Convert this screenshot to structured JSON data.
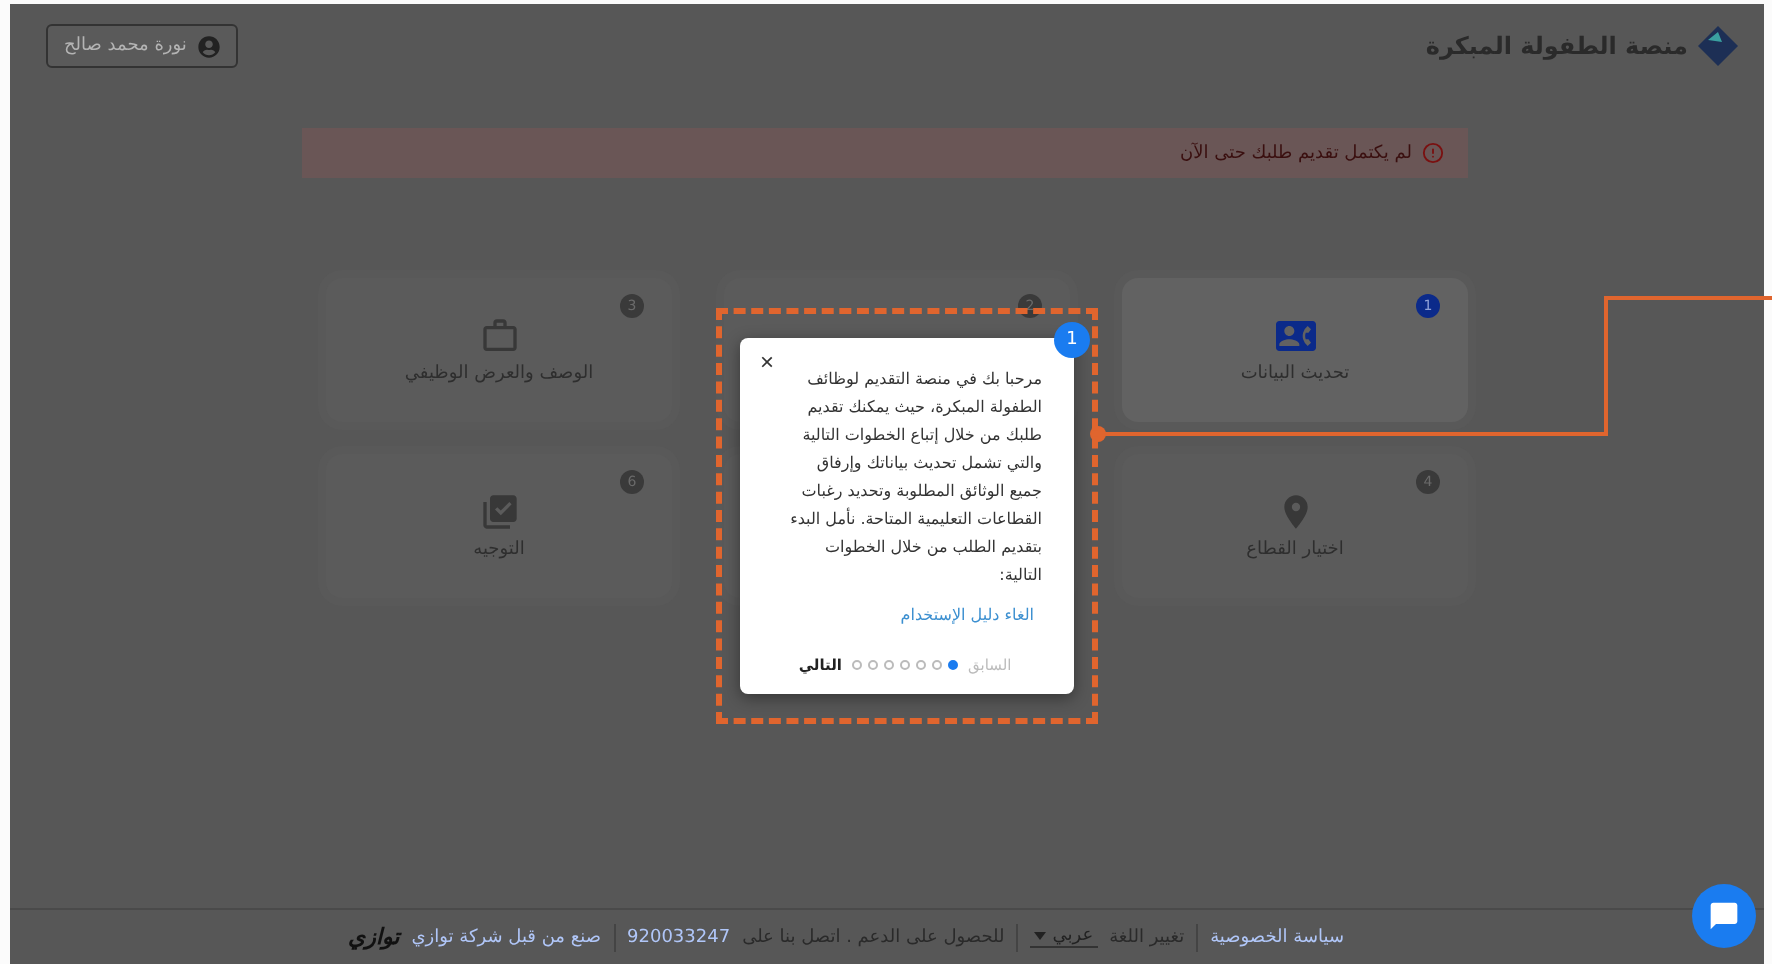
{
  "header": {
    "logo_text": "منصة الطفولة المبكرة",
    "user_button": "نورة محمد صالح"
  },
  "alert": {
    "text": "لم يكتمل تقديم طلبك حتى الآن"
  },
  "steps": [
    {
      "number": "1",
      "label": "تحديث البيانات",
      "kind": "contact",
      "active": true
    },
    {
      "number": "2",
      "kind": "blank",
      "active": false
    },
    {
      "number": "3",
      "label": "الوصف والعرض الوظيفي",
      "kind": "briefcase",
      "active": false
    },
    {
      "number": "4",
      "label": "اختيار القطاع",
      "kind": "pin",
      "active": false
    },
    {
      "kind": "blank"
    },
    {
      "number": "6",
      "label": "التوجيه",
      "kind": "checklist",
      "active": false
    }
  ],
  "tour": {
    "step_badge": "1",
    "text": "مرحبا بك في منصة التقديم لوظائف الطفولة المبكرة، حيث يمكنك تقديم طلبك من خلال إتباع الخطوات التالية والتي تشمل تحديث بياناتك وإرفاق جميع الوثائق المطلوبة وتحديد رغبات القطاعات التعليمية المتاحة. نأمل البدء بتقديم الطلب من خلال الخطوات التالية:",
    "close": "×",
    "skip_link": "الغاء دليل الإستخدام",
    "prev": {
      "label": "السابق",
      "disabled": true
    },
    "next": {
      "label": "التالي",
      "disabled": false
    },
    "dots": [
      {
        "selected": true
      },
      {
        "selected": false
      },
      {
        "selected": false
      },
      {
        "selected": false
      },
      {
        "selected": false
      },
      {
        "selected": false
      },
      {
        "selected": false
      }
    ]
  },
  "footer": {
    "privacy_link": "سياسة الخصوصية",
    "language_label": "تغيير اللغة",
    "language_value": "عربي",
    "support_text": "للحصول على الدعم . اتصل بنا على",
    "phone_link": "920033247",
    "made_by_link": "صنع من قبل شركة توازي",
    "brand_logo": "توازي"
  }
}
